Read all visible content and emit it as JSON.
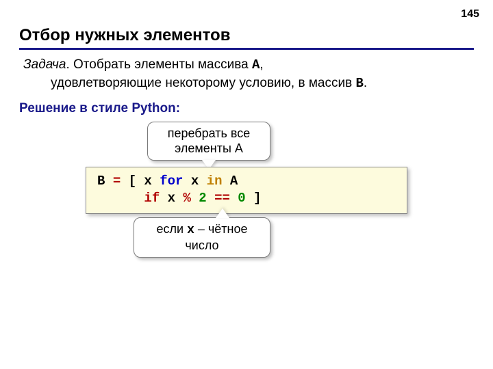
{
  "page_number": "145",
  "title": "Отбор нужных элементов",
  "task": {
    "label": "Задача",
    "line1_rest": ". Отобрать элементы массива ",
    "array_a": "A",
    "line1_end": ",",
    "line2_a": "удовлетворяющие некоторому условию, в массив ",
    "array_b": "B",
    "line2_end": "."
  },
  "solution_label": "Решение в стиле Python:",
  "callout_top": {
    "line1": "перебрать все",
    "line2": "элементы A"
  },
  "callout_bottom": {
    "prefix": "если ",
    "var": "x",
    "suffix": " – чётное",
    "line2": "число"
  },
  "code": {
    "t1": "B",
    "t2": "=",
    "t3": "[ x ",
    "kw_for": "for",
    "t4": " x ",
    "kw_in": "in",
    "t5": " A",
    "indent": "      ",
    "kw_if": "if",
    "t6": " x",
    "op_mod": "%",
    "num_2": "2",
    "op_eq": "==",
    "num_0": "0",
    "t7": " ]"
  }
}
